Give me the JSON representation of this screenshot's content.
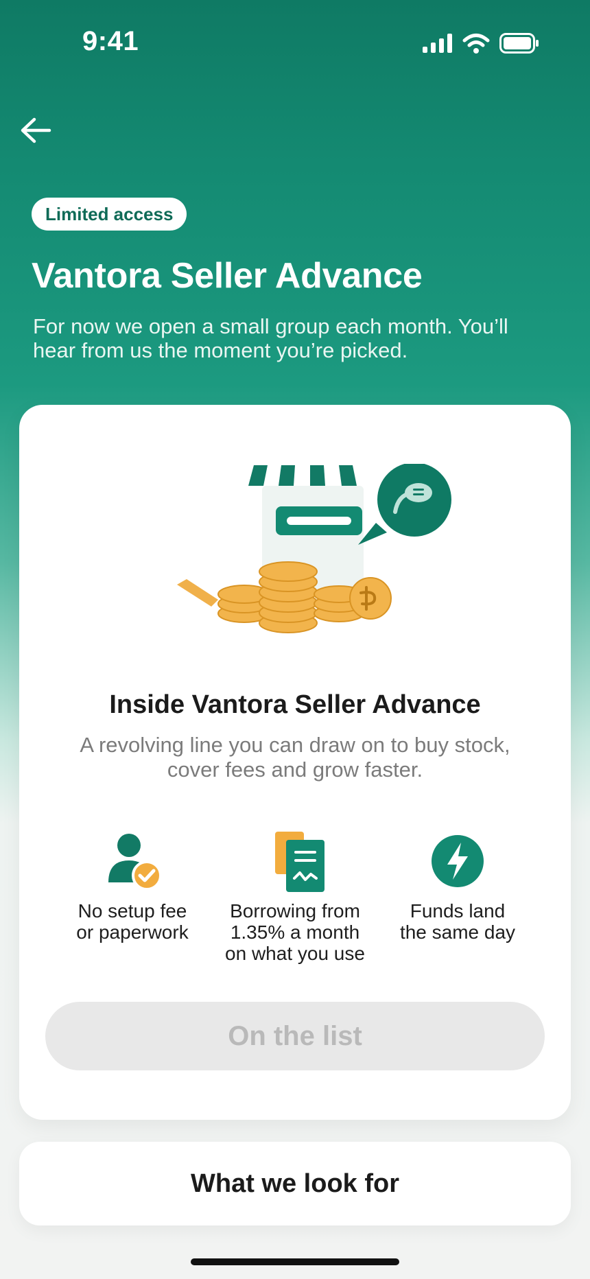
{
  "status_bar": {
    "time": "9:41",
    "icons": [
      "signal-icon",
      "wifi-icon",
      "battery-icon"
    ]
  },
  "nav": {
    "back_icon": "back-arrow-icon"
  },
  "header": {
    "badge": "Limited access",
    "title": "Vantora Seller Advance",
    "subtitle": "For now we open a small group each month. You’ll hear from us the moment you’re picked."
  },
  "card": {
    "illustration": "storefront-coins-illustration",
    "title": "Inside Vantora Seller Advance",
    "description": "A revolving line you can draw on to buy stock, cover fees and grow faster.",
    "features": [
      {
        "icon": "person-check-icon",
        "label": "No setup fee\nor paperwork"
      },
      {
        "icon": "document-icon",
        "label": "Borrowing from\n1.35% a month\non what you use"
      },
      {
        "icon": "lightning-icon",
        "label": "Funds land\nthe same day"
      }
    ],
    "button_label": "On the list"
  },
  "secondary": {
    "title": "What we look for"
  },
  "colors": {
    "brand_green": "#0f7a64",
    "accent_orange": "#f0a93a",
    "disabled_bg": "#e8e8e8"
  }
}
